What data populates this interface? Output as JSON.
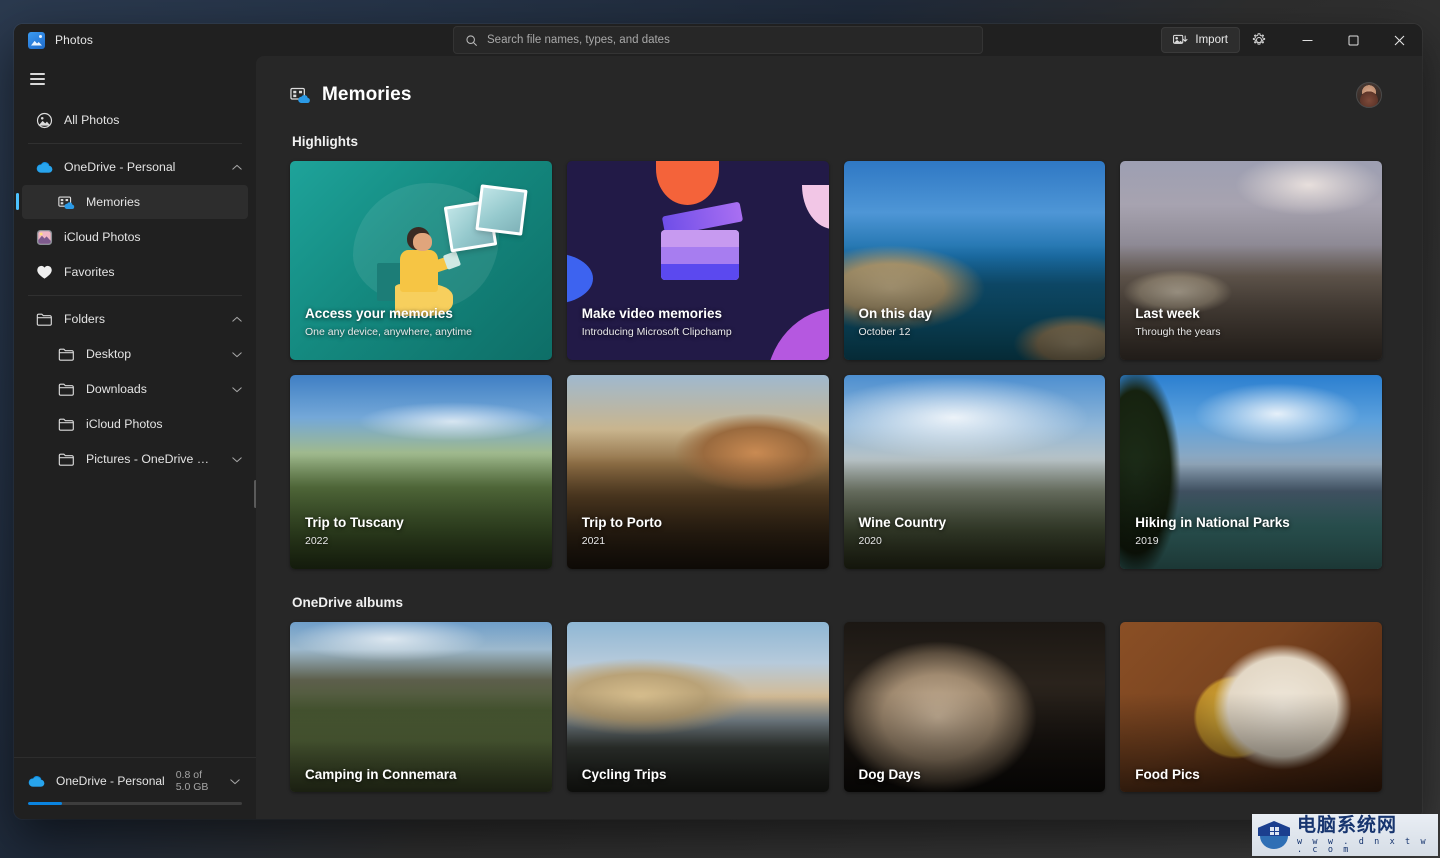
{
  "titlebar": {
    "app_name": "Photos",
    "app_icon": "photos-app-icon",
    "search_placeholder": "Search file names, types, and dates",
    "search_value": "",
    "import_label": "Import",
    "settings_icon": "gear-icon",
    "minimize_icon": "minimize-icon",
    "maximize_icon": "maximize-icon",
    "close_icon": "close-icon"
  },
  "sidebar": {
    "hamburger_label": "Navigation",
    "items": [
      {
        "label": "All Photos",
        "icon": "all-photos-icon",
        "level": 0,
        "selected": false,
        "chevron": ""
      },
      {
        "label": "OneDrive - Personal",
        "icon": "onedrive-cloud-icon",
        "level": 0,
        "selected": false,
        "chevron": "up"
      },
      {
        "label": "Memories",
        "icon": "memories-icon",
        "level": 1,
        "selected": true,
        "chevron": ""
      },
      {
        "label": "iCloud Photos",
        "icon": "icloud-photos-icon",
        "level": 0,
        "selected": false,
        "chevron": ""
      },
      {
        "label": "Favorites",
        "icon": "heart-icon",
        "level": 0,
        "selected": false,
        "chevron": ""
      },
      {
        "label": "Folders",
        "icon": "folder-icon",
        "level": 0,
        "selected": false,
        "chevron": "up"
      },
      {
        "label": "Desktop",
        "icon": "folder-icon",
        "level": 1,
        "selected": false,
        "chevron": "down"
      },
      {
        "label": "Downloads",
        "icon": "folder-icon",
        "level": 1,
        "selected": false,
        "chevron": "down"
      },
      {
        "label": "iCloud Photos",
        "icon": "folder-icon",
        "level": 1,
        "selected": false,
        "chevron": ""
      },
      {
        "label": "Pictures - OneDrive Personal",
        "icon": "folder-icon",
        "level": 1,
        "selected": false,
        "chevron": "down"
      }
    ],
    "storage": {
      "account": "OneDrive - Personal",
      "amount": "0.8 of 5.0 GB",
      "percent": 16,
      "chevron": "down",
      "icon": "onedrive-cloud-icon"
    }
  },
  "main": {
    "page_title": "Memories",
    "page_icon": "memories-icon",
    "avatar": "user-avatar",
    "sections": [
      {
        "title": "Highlights",
        "rows": [
          [
            {
              "title": "Access your memories",
              "subtitle": "One any device, anywhere, anytime",
              "art": "promo-teal"
            },
            {
              "title": "Make video memories",
              "subtitle": "Introducing Microsoft Clipchamp",
              "art": "promo-navy"
            },
            {
              "title": "On this day",
              "subtitle": "October 12",
              "art": "ph-onthisday"
            },
            {
              "title": "Last week",
              "subtitle": "Through the years",
              "art": "ph-lastweek"
            }
          ],
          [
            {
              "title": "Trip to Tuscany",
              "subtitle": "2022",
              "art": "ph-tuscany"
            },
            {
              "title": "Trip to Porto",
              "subtitle": "2021",
              "art": "ph-porto"
            },
            {
              "title": "Wine Country",
              "subtitle": "2020",
              "art": "ph-wine"
            },
            {
              "title": "Hiking in National Parks",
              "subtitle": "2019",
              "art": "ph-hiking"
            }
          ]
        ]
      },
      {
        "title": "OneDrive albums",
        "rows": [
          [
            {
              "title": "Camping in Connemara",
              "subtitle": "",
              "art": "ph-camping"
            },
            {
              "title": "Cycling Trips",
              "subtitle": "",
              "art": "ph-cycling"
            },
            {
              "title": "Dog Days",
              "subtitle": "",
              "art": "ph-dog"
            },
            {
              "title": "Food Pics",
              "subtitle": "",
              "art": "ph-food"
            }
          ]
        ]
      }
    ]
  },
  "watermark": {
    "name": "电脑系统网",
    "url": "w w w . d n x t w . c o m"
  },
  "colors": {
    "accent": "#4cc2ff",
    "onedrive_blue": "#0a84e0",
    "window_bg": "#202020",
    "content_bg": "#272727"
  }
}
